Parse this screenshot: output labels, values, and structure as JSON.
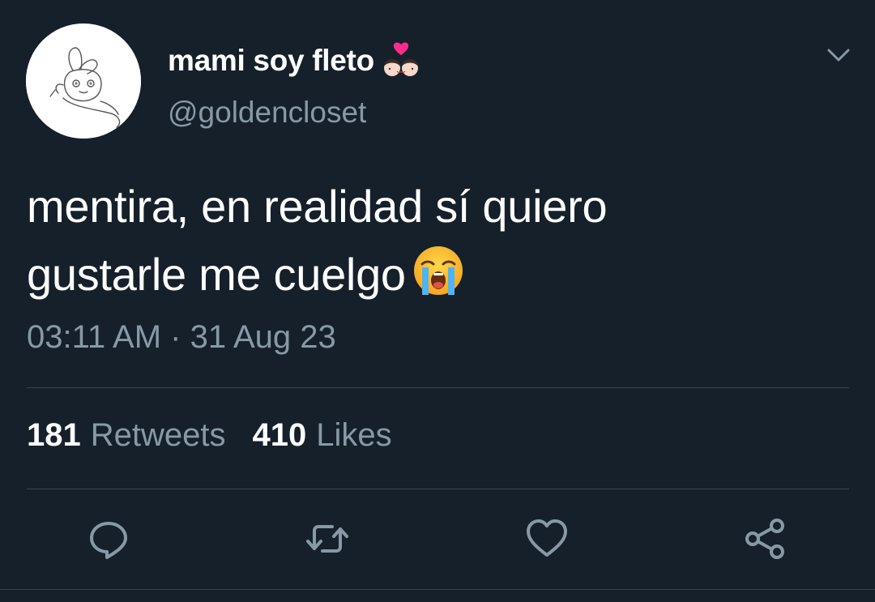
{
  "user": {
    "display_name": "mami soy fleto",
    "display_name_emoji": "kissing-couple-emoji",
    "handle": "@goldencloset",
    "avatar": "bunny-drawing-avatar"
  },
  "tweet": {
    "text_line1": "mentira, en realidad sí quiero",
    "text_line2": "gustarle me cuelgo",
    "text_emoji": "loudly-crying-face-emoji",
    "timestamp": "03:11 AM · 31 Aug 23"
  },
  "stats": {
    "retweets_count": "181",
    "retweets_label": "Retweets",
    "likes_count": "410",
    "likes_label": "Likes"
  },
  "actions": [
    "reply-icon",
    "retweet-icon",
    "like-icon",
    "share-icon"
  ],
  "colors": {
    "background": "#15202b",
    "text_primary": "#ffffff",
    "text_secondary": "#8899a6",
    "divider": "#38444d",
    "icon": "#8899a6"
  }
}
